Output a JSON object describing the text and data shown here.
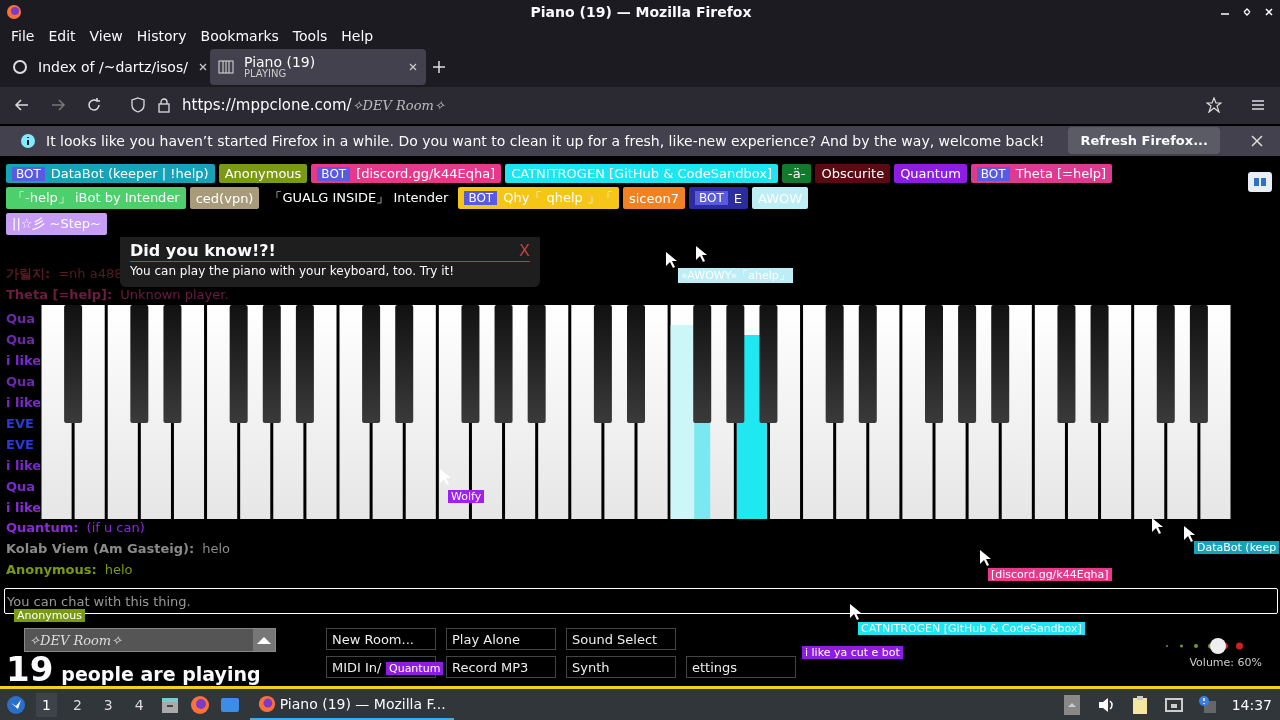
{
  "window": {
    "title": "Piano (19) — Mozilla Firefox"
  },
  "menu": [
    "File",
    "Edit",
    "View",
    "History",
    "Bookmarks",
    "Tools",
    "Help"
  ],
  "tabs": [
    {
      "label": "Index of /~dartz/isos/",
      "selected": false
    },
    {
      "label": "Piano (19)",
      "sub": "PLAYING",
      "selected": true
    }
  ],
  "address": {
    "host": "https://mppclone.com/",
    "path": "✧DEV Room✧"
  },
  "notice": {
    "text": "It looks like you haven’t started Firefox in a while. Do you want to clean it up for a fresh, like-new experience? And by the way, welcome back!",
    "button": "Refresh Firefox..."
  },
  "users": [
    [
      {
        "name": "DataBot (keeper | !help)",
        "badge": "BOT",
        "color": "#17a2b8"
      },
      {
        "name": "Anonymous",
        "color": "#7b9a14"
      },
      {
        "name": "[discord.gg/k44Eqha]",
        "badge": "BOT",
        "color": "#e8388c"
      },
      {
        "name": "CATNITROGEN [GitHub & CodeSandbox]",
        "color": "#1de6f2"
      },
      {
        "name": "-ä-",
        "color": "#117a2c"
      },
      {
        "name": "Obscurite",
        "color": "#5a0a12"
      },
      {
        "name": "Quantum",
        "color": "#8d1de3"
      },
      {
        "name": "Theta [=help]",
        "badge": "BOT",
        "color": "#dd3b91"
      }
    ],
    [
      {
        "name": "「-help」 iBot by Intender",
        "color": "#4dcf6b"
      },
      {
        "name": "ced(vpn)",
        "color": "#a89b7a"
      },
      {
        "name": "「GUALG INSIDE」 Intender",
        "color": "#000000"
      },
      {
        "name": "Qhy「 qhelp 」「",
        "badge": "BOT",
        "color": "#f5c518"
      },
      {
        "name": "siceon7",
        "color": "#f08222"
      },
      {
        "name": "E",
        "badge": "BOT",
        "color": "#2b2ca3"
      },
      {
        "name": "AWOW",
        "color": "#bdeef6"
      }
    ],
    [
      {
        "name": "||☆彡 ~Step~",
        "color": "#c79ef5"
      }
    ]
  ],
  "tip": {
    "title": "Did you know!?!",
    "text": "You can play the piano with your keyboard, too. Try it!",
    "close": "X"
  },
  "chat_top": [
    {
      "name": "가릴지:",
      "text": "=nh a488",
      "color": "#5a1a22"
    },
    {
      "name": "Theta [=help]:",
      "text": "Unknown player.",
      "color": "#6e1c40"
    }
  ],
  "chat_cut": [
    {
      "text": "Qua",
      "color": "#6a2aa8"
    },
    {
      "text": "Qua",
      "color": "#6a2aa8"
    },
    {
      "text": "i like",
      "color": "#7a2ac8"
    },
    {
      "text": "Qua",
      "color": "#6a2aa8"
    },
    {
      "text": "i like",
      "color": "#7a2ac8"
    },
    {
      "text": "EVE",
      "color": "#2a3ad8"
    },
    {
      "text": "EVE",
      "color": "#2a3ad8"
    },
    {
      "text": "i like",
      "color": "#7a2ac8"
    },
    {
      "text": "Qua",
      "color": "#7a2ac8"
    },
    {
      "text": "i like",
      "color": "#8a2ad8"
    }
  ],
  "chat": [
    {
      "name": "Quantum:",
      "text": "(if u can)",
      "color": "#8a2ad8"
    },
    {
      "name": "Kolab Viem (Am Gasteig):",
      "text": "helo",
      "color": "#8a8a8a"
    },
    {
      "name": "Anonymous:",
      "text": "helo",
      "color": "#7b9a14"
    }
  ],
  "chat_input": {
    "placeholder": "You can chat with this thing."
  },
  "room": "✧DEV Room✧",
  "count": {
    "number": "19",
    "label": "people are playing"
  },
  "buttons": [
    [
      "New Room...",
      "Play Alone",
      "Sound Select"
    ],
    [
      "MIDI In/",
      "Record MP3",
      "Synth",
      "ettings"
    ]
  ],
  "volume": {
    "label": "Volume: 60%",
    "level": 0.6
  },
  "cursors": [
    {
      "name": "Wolfy",
      "color": "#a020f0"
    },
    {
      "name": "Anonymous",
      "color": "#7b9a14"
    },
    {
      "name": "Quantum",
      "color": "#8d1de3"
    },
    {
      "name": "i like ya cut e bot",
      "color": "#8d1de3"
    },
    {
      "name": "[discord.gg/k44Eqha]",
      "color": "#e8388c"
    },
    {
      "name": "CATNITROGEN [GitHub & CodeSandbox]",
      "color": "#1de6f2"
    },
    {
      "name": "DataBot (keep",
      "color": "#17a2b8"
    },
    {
      "name": "»AWOWY»「ahelp」",
      "color": "#bdeef6"
    }
  ],
  "taskbar": {
    "workspaces": [
      {
        "label": "1",
        "selected": true
      },
      {
        "label": "2",
        "selected": false
      },
      {
        "label": "3",
        "selected": false
      },
      {
        "label": "4",
        "selected": false
      }
    ],
    "task": "Piano (19) — Mozilla F...",
    "clock": "14:37"
  }
}
